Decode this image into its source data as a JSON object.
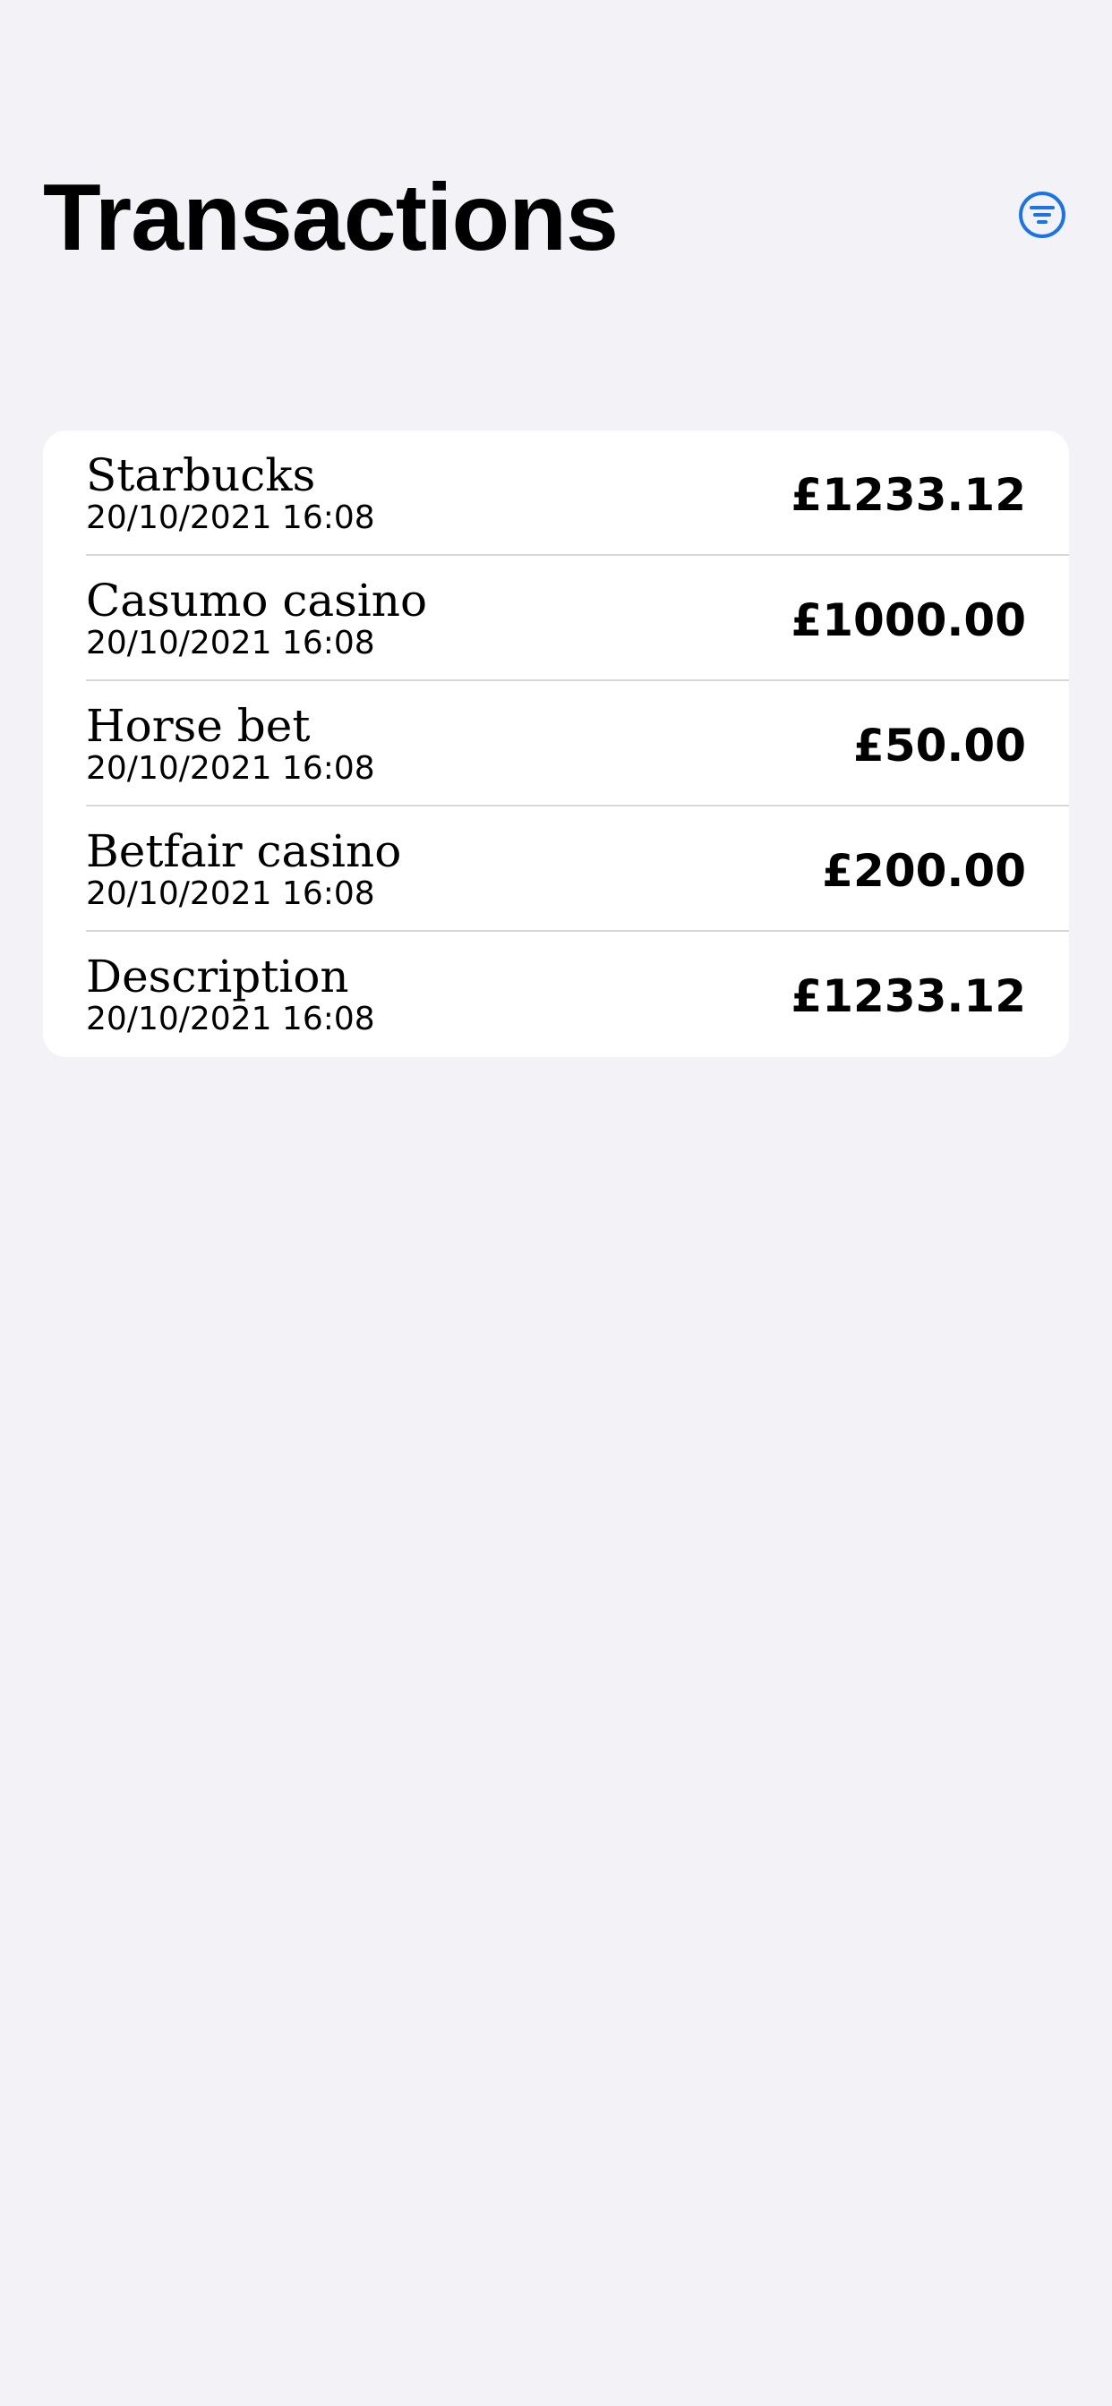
{
  "header": {
    "title": "Transactions",
    "filter_icon": "line-3-horizontal-decrease-circle-icon",
    "accent_color": "#1a73e8"
  },
  "transactions": [
    {
      "description": "Starbucks",
      "datetime": "20/10/2021 16:08",
      "amount": "£1233.12"
    },
    {
      "description": "Casumo casino",
      "datetime": "20/10/2021 16:08",
      "amount": "£1000.00"
    },
    {
      "description": "Horse bet",
      "datetime": "20/10/2021 16:08",
      "amount": "£50.00"
    },
    {
      "description": "Betfair casino",
      "datetime": "20/10/2021 16:08",
      "amount": "£200.00"
    },
    {
      "description": "Description",
      "datetime": "20/10/2021 16:08",
      "amount": "£1233.12"
    }
  ]
}
